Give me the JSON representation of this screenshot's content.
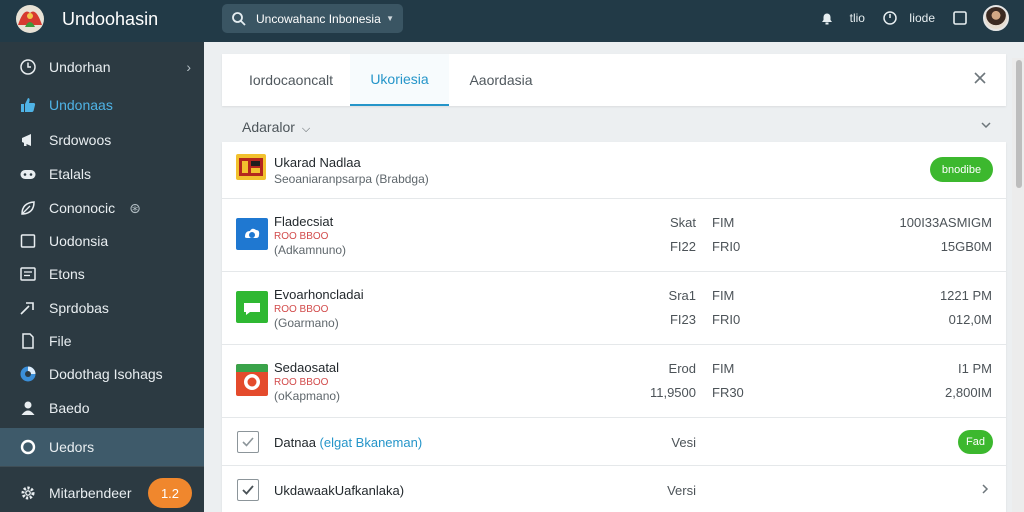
{
  "app": {
    "title": "Undoohasin"
  },
  "search": {
    "text": "Uncowahanc Inbonesia"
  },
  "topbar": {
    "text1": "tlio",
    "text2": "Iiode"
  },
  "sidebar": {
    "items": [
      {
        "label": "Undorhan",
        "icon": "clock-icon"
      },
      {
        "label": "Undonaas",
        "icon": "thumbs-up-icon"
      },
      {
        "label": "Srdowoos",
        "icon": "megaphone-icon"
      },
      {
        "label": "Etalals",
        "icon": "gamepad-icon"
      },
      {
        "label": "Cononocic",
        "icon": "leaf-icon"
      },
      {
        "label": "Uodonsia",
        "icon": "square-icon"
      },
      {
        "label": "Etons",
        "icon": "image-icon"
      },
      {
        "label": "Sprdobas",
        "icon": "share-icon"
      },
      {
        "label": "File",
        "icon": "file-icon"
      },
      {
        "label": "Dodothag Isohags",
        "icon": "browser-icon"
      },
      {
        "label": "Baedo",
        "icon": "user-icon"
      },
      {
        "label": "Uedors",
        "icon": "circle-icon"
      },
      {
        "label": "Mitarbendeer",
        "icon": "gear-icon"
      }
    ],
    "badge": "1.2"
  },
  "tabs": [
    {
      "label": "Iordocaoncalt"
    },
    {
      "label": "Ukoriesia"
    },
    {
      "label": "Aaordasia"
    }
  ],
  "filter": {
    "label": "Adaralor"
  },
  "rows": [
    {
      "title": "Ukarad Nadlaa",
      "subtitle": "Seoaniaranpsarpa (Brabdga)",
      "action": "bnodibe"
    },
    {
      "title": "Fladecsiat",
      "sub1": "ROO BBOO",
      "sub2": "(Adkamnuno)",
      "c1a": "Skat",
      "c2a": "FIM",
      "c3a": "100I33ASMIGM",
      "c1b": "FI22",
      "c2b": "FRI0",
      "c3b": "15GB0M"
    },
    {
      "title": "Evoarhoncladai",
      "sub1": "ROO BBOO",
      "sub2": "(Goarmano)",
      "c1a": "Sra1",
      "c2a": "FIM",
      "c3a": "1221 PM",
      "c1b": "FI23",
      "c2b": "FRI0",
      "c3b": "012,0M"
    },
    {
      "title": "Sedaosatal",
      "sub1": "ROO BBOO",
      "sub2": "(oKapmano)",
      "c1a": "Erod",
      "c2a": "FIM",
      "c3a": "I1 PM",
      "c1b": "11,9500",
      "c2b": "FR30",
      "c3b": "2,800IM"
    },
    {
      "title": "Datnaa",
      "title_link": "(elgat Bkaneman)",
      "c1": "Vesi",
      "action": "Fad"
    },
    {
      "title": "UkdawaakUafkanlaka)",
      "c1": "Versi"
    }
  ],
  "colors": {
    "topbar": "#223a47",
    "sidebar": "#2c3a42",
    "accent": "#2595c9",
    "green": "#3cb82e",
    "badge": "#f0872d"
  }
}
